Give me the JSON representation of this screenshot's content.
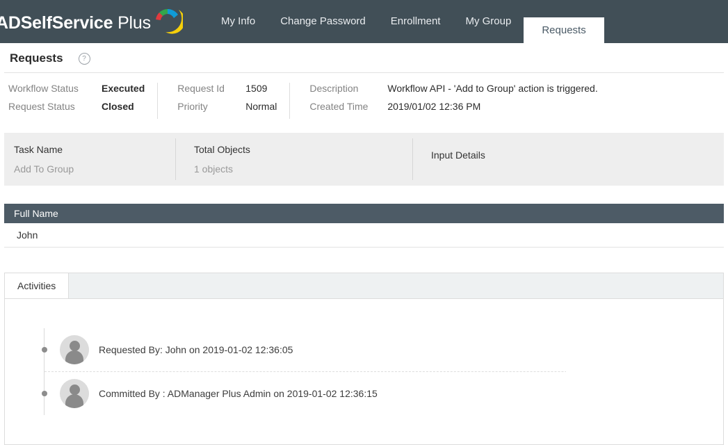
{
  "header": {
    "brand_prefix": "ADSelfService",
    "brand_suffix": " Plus",
    "logo_icon": "adselfservice-swirl-logo",
    "nav": [
      {
        "label": "My Info",
        "active": false
      },
      {
        "label": "Change Password",
        "active": false
      },
      {
        "label": "Enrollment",
        "active": false
      },
      {
        "label": "My Group",
        "active": false
      },
      {
        "label": "Requests",
        "active": true
      }
    ],
    "bar_color": "#414f57",
    "active_tab_color": "#ffffff"
  },
  "page": {
    "title": "Requests",
    "help_icon": "question-mark-help-icon",
    "help_glyph": "?"
  },
  "summary": {
    "col1": [
      {
        "label": "Workflow Status",
        "value": "Executed"
      },
      {
        "label": "Request Status",
        "value": "Closed"
      }
    ],
    "col2": [
      {
        "label": "Request Id",
        "value": "1509"
      },
      {
        "label": "Priority",
        "value": "Normal"
      }
    ],
    "col3": [
      {
        "label": "Description",
        "value": "Workflow API - 'Add to Group' action is triggered."
      },
      {
        "label": "Created Time",
        "value": "2019/01/02 12:36 PM"
      }
    ]
  },
  "task_panel": {
    "background": "#eeeeee",
    "cells": [
      {
        "head": "Task Name",
        "sub": "Add To Group"
      },
      {
        "head": "Total Objects",
        "sub": "1 objects"
      },
      {
        "head": "Input Details",
        "sub": ""
      }
    ]
  },
  "objects_table": {
    "header_color": "#4d5b66",
    "columns": [
      "Full Name"
    ],
    "rows": [
      [
        "John"
      ]
    ]
  },
  "activities": {
    "tabs": [
      {
        "label": "Activities",
        "active": true
      }
    ],
    "items": [
      {
        "avatar": "user-avatar-placeholder",
        "text": "Requested By: John on 2019-01-02 12:36:05"
      },
      {
        "avatar": "user-avatar-placeholder",
        "text": "Committed By : ADManager Plus Admin on 2019-01-02 12:36:15"
      }
    ]
  }
}
